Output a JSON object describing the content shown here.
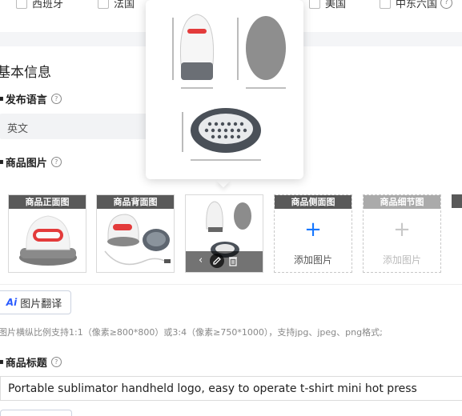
{
  "regions": [
    {
      "label": "西班牙",
      "checked": false
    },
    {
      "label": "法国",
      "checked": false
    },
    {
      "label": "美国",
      "checked": false
    },
    {
      "label": "中东六国",
      "checked": false
    }
  ],
  "section_title": "基本信息",
  "language": {
    "label": "发布语言",
    "value": "英文"
  },
  "images": {
    "label": "商品图片",
    "cards": [
      {
        "label": "商品正面图"
      },
      {
        "label": "商品背面图"
      },
      {
        "label": ""
      },
      {
        "label": "商品侧面图",
        "add": "添加图片"
      },
      {
        "label": "商品细节图",
        "add": "添加图片"
      }
    ],
    "translate_button": "图片翻译",
    "translate_ai": "Ai",
    "hint": "图片横纵比例支持1:1（像素≥800*800）或3:4（像素≥750*1000），支持jpg、jpeg、png格式;"
  },
  "product_title": {
    "label": "商品标题",
    "value": "Portable sublimator handheld logo, easy to operate t-shirt mini hot press"
  },
  "help_glyph": "?",
  "plus_glyph": "+",
  "colors": {
    "accent": "#1677ff",
    "label_bg": "#595959",
    "press_red": "#e33b3b"
  }
}
